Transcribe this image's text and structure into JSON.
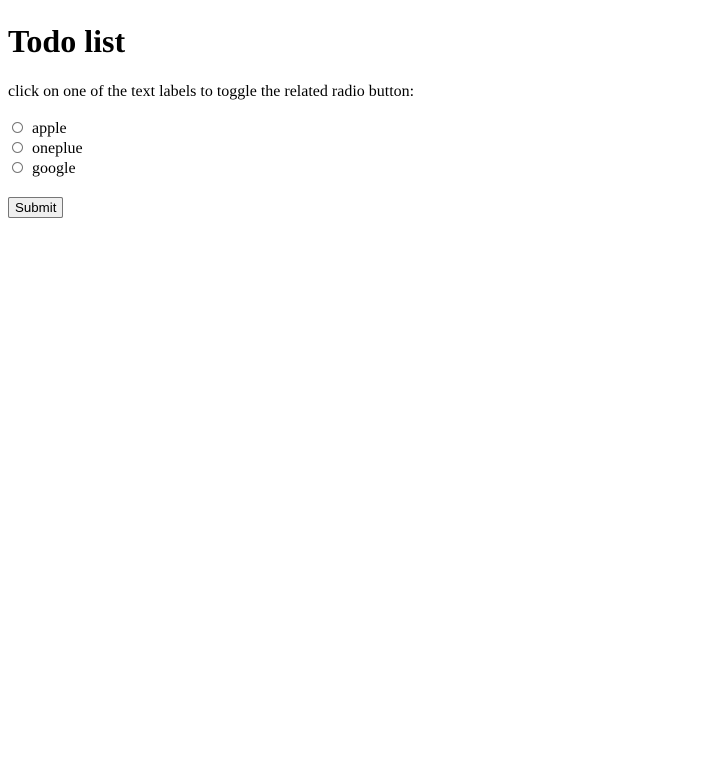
{
  "page": {
    "title": "Todo list",
    "instructions": "click on one of the text labels to toggle the related radio button:"
  },
  "options": [
    {
      "label": "apple",
      "checked": false
    },
    {
      "label": "oneplue",
      "checked": false
    },
    {
      "label": "google",
      "checked": false
    }
  ],
  "form": {
    "submit_label": "Submit"
  }
}
